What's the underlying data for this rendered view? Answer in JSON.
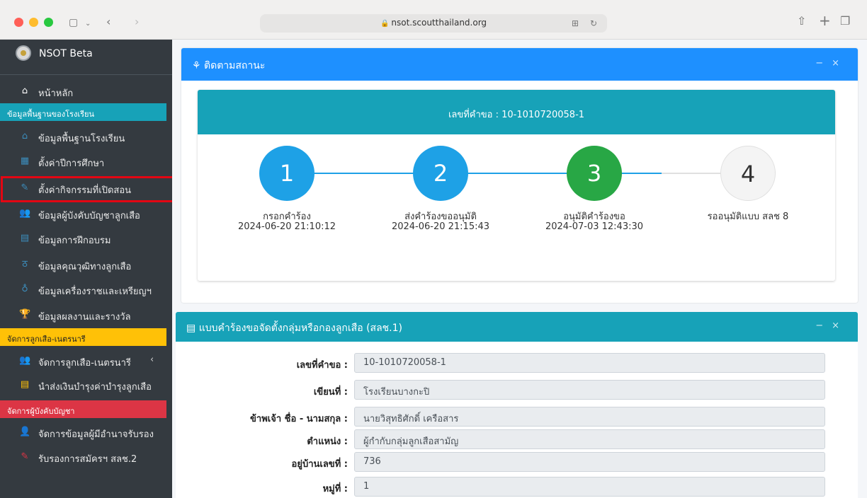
{
  "browser": {
    "url": "nsot.scoutthailand.org"
  },
  "sidebar": {
    "brand": "NSOT Beta",
    "home": "หน้าหลัก",
    "sections": {
      "school": "ข้อมูลพื้นฐานของโรงเรียน",
      "scouts": "จัดการลูกเสือ-เนตรนารี",
      "commanders": "จัดการผู้บังคับบัญชา"
    },
    "items": [
      "ข้อมูลพื้นฐานโรงเรียน",
      "ตั้งค่าปีการศึกษา",
      "ตั้งค่ากิจกรรมที่เปิดสอน",
      "ข้อมูลผู้บังคับบัญชาลูกเสือ",
      "ข้อมูลการฝึกอบรม",
      "ข้อมูลคุณวุฒิทางลูกเสือ",
      "ข้อมูลเครื่องราชและเหรียญฯ",
      "ข้อมูลผลงานและรางวัล",
      "จัดการลูกเสือ-เนตรนารี",
      "นำส่งเงินบำรุงค่าบำรุงลูกเสือ",
      "จัดการข้อมูลผู้มีอำนาจรับรอง",
      "รับรองการสมัครฯ สลช.2"
    ],
    "colors": {
      "school": "#17a2b8",
      "scouts": "#ffc107",
      "commanders": "#dc3545",
      "highlight": "#e30613"
    }
  },
  "tracking": {
    "title": "ติดตามสถานะ",
    "request_no_label": "เลขที่คำขอ : 10-1010720058-1",
    "steps": [
      {
        "num": "1",
        "label": "กรอกคำร้อง",
        "date": "2024-06-20 21:10:12",
        "color": "#1ea1e6"
      },
      {
        "num": "2",
        "label": "ส่งคำร้องขออนุมัติ",
        "date": "2024-06-20 21:15:43",
        "color": "#1ea1e6"
      },
      {
        "num": "3",
        "label": "อนุมัติคำร้องขอ",
        "date": "2024-07-03 12:43:30",
        "color": "#28a745"
      },
      {
        "num": "4",
        "label": "รออนุมัติแบบ สลช 8",
        "date": "",
        "color": "#f4f4f4"
      }
    ]
  },
  "form": {
    "title": "แบบคำร้องขอจัดตั้งกลุ่มหรือกองลูกเสือ (สลช.1)",
    "fields": [
      {
        "label": "เลขที่คำขอ :",
        "value": "10-1010720058-1"
      },
      {
        "label": "เขียนที่ :",
        "value": "โรงเรียนบางกะปิ"
      },
      {
        "label": "ข้าพเจ้า ชื่อ - นามสกุล :",
        "value": "นายวิสุทธิศักดิ์ เครือสาร"
      },
      {
        "label": "ตำแหน่ง :",
        "value": "ผู้กำกับกลุ่มลูกเสือสามัญ"
      },
      {
        "label": "อยู่บ้านเลขที่ :",
        "value": "736"
      },
      {
        "label": "หมู่ที่ :",
        "value": "1"
      }
    ]
  }
}
